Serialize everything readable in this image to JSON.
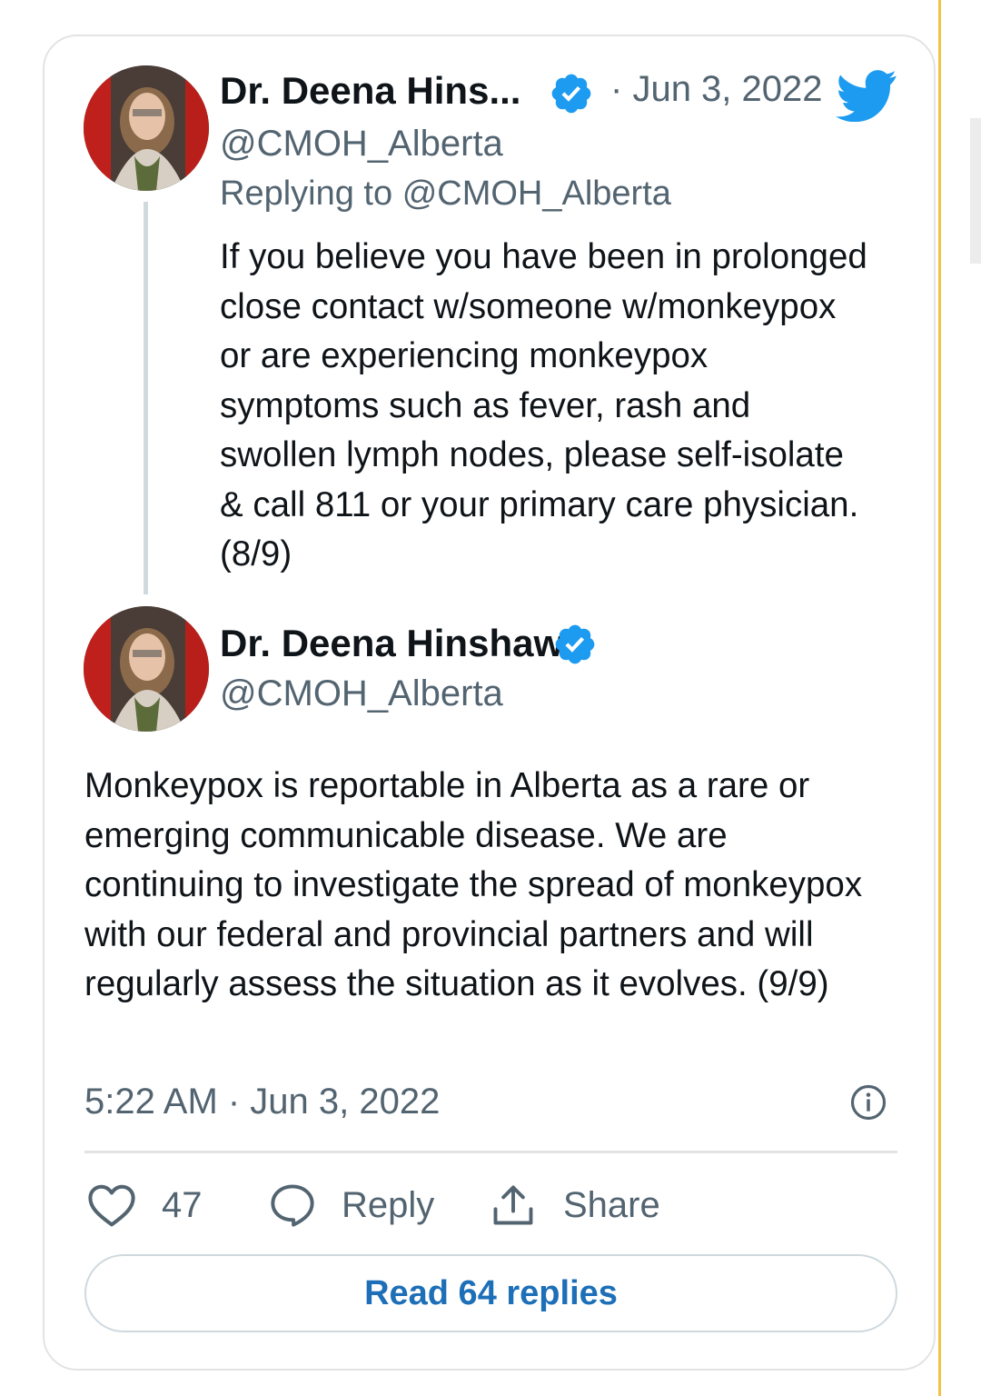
{
  "colors": {
    "accent": "#1d9bf0",
    "link": "#1d6fb8",
    "text_primary": "#0f1419",
    "text_secondary": "#536471",
    "border": "#e3e3e3"
  },
  "icons": {
    "verified": "verified-badge-icon",
    "bird": "twitter-bird-icon",
    "info": "info-icon",
    "like": "heart-icon",
    "reply": "speech-bubble-icon",
    "share": "share-upload-icon"
  },
  "tweet_parent": {
    "author_name": "Dr. Deena Hins...",
    "separator": "·",
    "date": "Jun 3, 2022",
    "handle": "@CMOH_Alberta",
    "replying_prefix": "Replying to",
    "replying_to": "@CMOH_Alberta",
    "text": "If you believe you have been in prolonged close contact w/someone w/monkeypox or are experiencing monkeypox symptoms such as fever, rash and swollen lymph nodes, please self-isolate & call 811 or your primary care physician. (8/9)"
  },
  "tweet_main": {
    "author_name": "Dr. Deena Hinshaw",
    "handle": "@CMOH_Alberta",
    "text": "Monkeypox is reportable in Alberta as a rare or emerging communicable disease. We are continuing to investigate the spread of monkeypox with our federal and provincial partners and will regularly assess the situation as it evolves. (9/9)",
    "timestamp": "5:22 AM · Jun 3, 2022"
  },
  "actions": {
    "like_count": "47",
    "reply_label": "Reply",
    "share_label": "Share"
  },
  "read_replies_label": "Read 64 replies"
}
